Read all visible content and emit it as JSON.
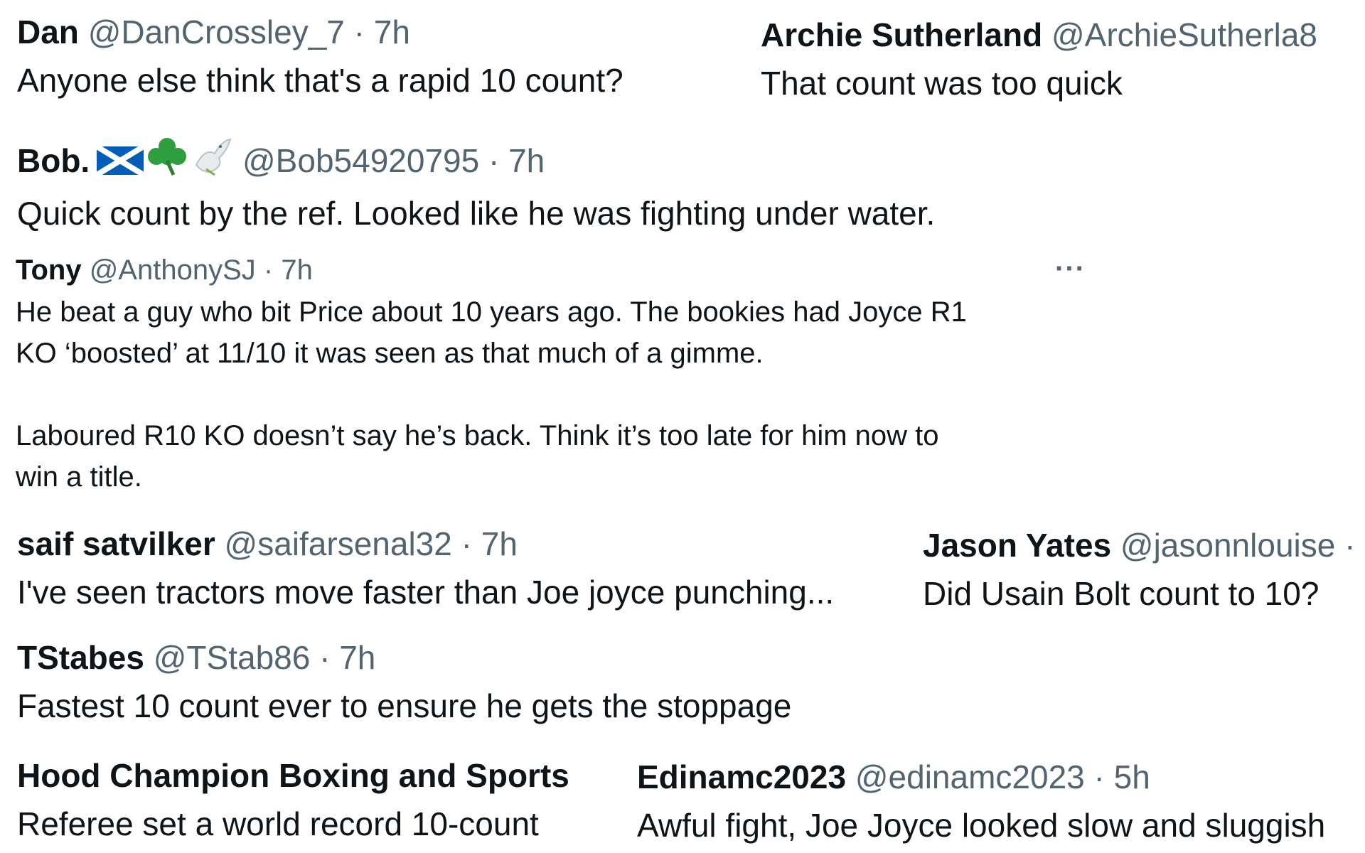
{
  "colors": {
    "name": "#0f1419",
    "meta": "#536471",
    "background": "#ffffff"
  },
  "tweets": [
    {
      "name": "Dan",
      "handle": "@DanCrossley_7",
      "sep": "·",
      "time": "7h",
      "text": "Anyone else think that's a rapid 10 count?"
    },
    {
      "name": "Archie Sutherland",
      "handle": "@ArchieSutherla8",
      "text": "That count was too quick"
    },
    {
      "name": "Bob.",
      "emoji": [
        "scotland-flag-icon",
        "shamrock-icon",
        "dove-icon"
      ],
      "handle": "@Bob54920795",
      "sep": "·",
      "time": "7h",
      "text": "Quick count by the ref. Looked like he was fighting under water."
    },
    {
      "name": "Tony",
      "handle": "@AnthonySJ",
      "sep": "·",
      "time": "7h",
      "more": "···",
      "line1": "He beat a guy who bit Price about 10 years ago. The bookies had Joyce R1",
      "line2": "KO ‘boosted’ at 11/10 it was seen as that much of a gimme.",
      "line3": "Laboured R10 KO doesn’t say he’s back. Think it’s too late for him now to",
      "line4": "win a title."
    },
    {
      "name": "saif satvilker",
      "handle": "@saifarsenal32",
      "sep": "·",
      "time": "7h",
      "text": "I've seen tractors move faster than Joe joyce punching..."
    },
    {
      "name": "Jason Yates",
      "handle": "@jasonnlouise",
      "sep": "·",
      "text": "Did Usain Bolt count to 10?"
    },
    {
      "name": "TStabes",
      "handle": "@TStab86",
      "sep": "·",
      "time": "7h",
      "text": "Fastest 10 count ever to ensure he gets the stoppage"
    },
    {
      "name": "Hood Champion Boxing and Sports",
      "text": "Referee set a world record 10-count"
    },
    {
      "name": "Edinamc2023",
      "handle": "@edinamc2023",
      "sep": "·",
      "time": "5h",
      "text": "Awful fight, Joe Joyce looked slow and sluggish"
    }
  ]
}
